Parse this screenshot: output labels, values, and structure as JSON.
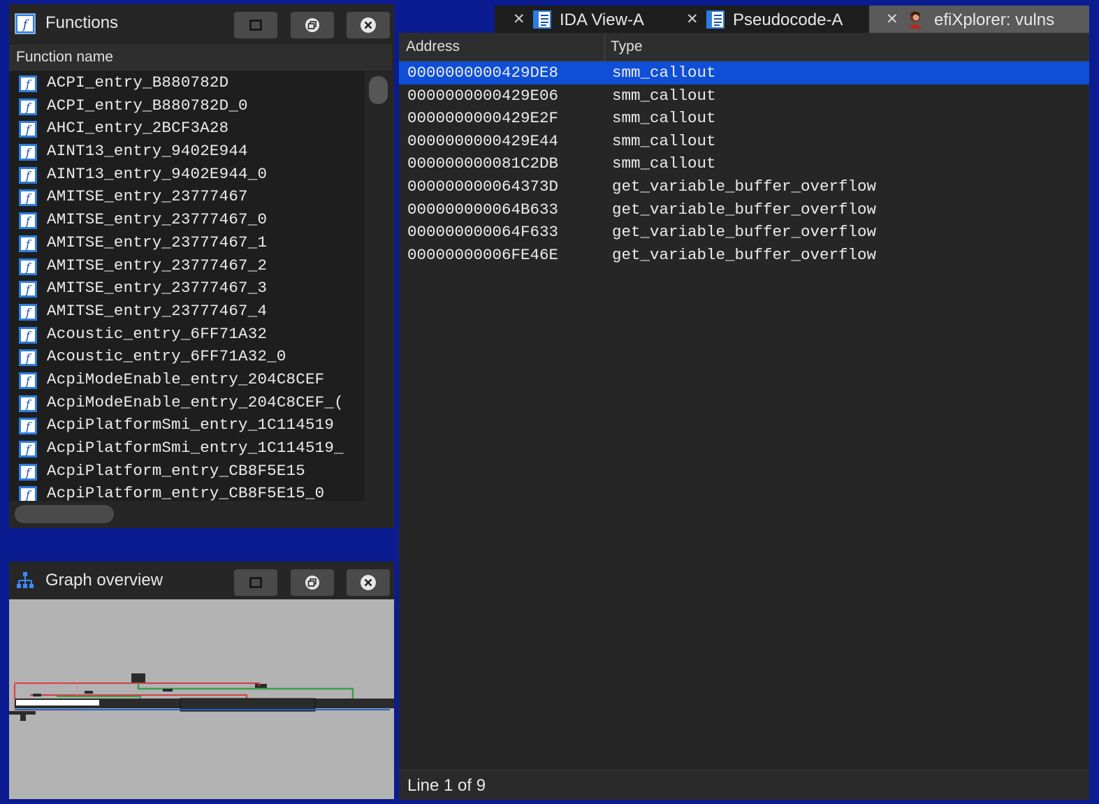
{
  "functions_panel": {
    "title": "Functions",
    "column_header": "Function name",
    "icon": "function-f-icon",
    "items": [
      "ACPI_entry_B880782D",
      "ACPI_entry_B880782D_0",
      "AHCI_entry_2BCF3A28",
      "AINT13_entry_9402E944",
      "AINT13_entry_9402E944_0",
      "AMITSE_entry_23777467",
      "AMITSE_entry_23777467_0",
      "AMITSE_entry_23777467_1",
      "AMITSE_entry_23777467_2",
      "AMITSE_entry_23777467_3",
      "AMITSE_entry_23777467_4",
      "Acoustic_entry_6FF71A32",
      "Acoustic_entry_6FF71A32_0",
      "AcpiModeEnable_entry_204C8CEF",
      "AcpiModeEnable_entry_204C8CEF_(",
      "AcpiPlatformSmi_entry_1C114519",
      "AcpiPlatformSmi_entry_1C114519_",
      "AcpiPlatform_entry_CB8F5E15",
      "AcpiPlatform_entry_CB8F5E15_0"
    ]
  },
  "graph_panel": {
    "title": "Graph overview",
    "icon": "graph-tree-icon"
  },
  "tabs": [
    {
      "label": "IDA View-A",
      "icon": "ida-view-icon",
      "active": false
    },
    {
      "label": "Pseudocode-A",
      "icon": "pseudocode-icon",
      "active": false
    },
    {
      "label": "efiXplorer: vulns",
      "icon": "efixplorer-avatar-icon",
      "active": true
    }
  ],
  "vulns_table": {
    "columns": [
      "Address",
      "Type"
    ],
    "rows": [
      {
        "address": "0000000000429DE8",
        "type": "smm_callout",
        "selected": true
      },
      {
        "address": "0000000000429E06",
        "type": "smm_callout"
      },
      {
        "address": "0000000000429E2F",
        "type": "smm_callout"
      },
      {
        "address": "0000000000429E44",
        "type": "smm_callout"
      },
      {
        "address": "000000000081C2DB",
        "type": "smm_callout"
      },
      {
        "address": "000000000064373D",
        "type": "get_variable_buffer_overflow"
      },
      {
        "address": "000000000064B633",
        "type": "get_variable_buffer_overflow"
      },
      {
        "address": "000000000064F633",
        "type": "get_variable_buffer_overflow"
      },
      {
        "address": "00000000006FE46E",
        "type": "get_variable_buffer_overflow"
      }
    ]
  },
  "status": "Line 1 of 9",
  "colors": {
    "background": "#0a1c8f",
    "selection": "#0f4fd6",
    "panel": "#262626",
    "active_tab": "#5a5a5a"
  }
}
